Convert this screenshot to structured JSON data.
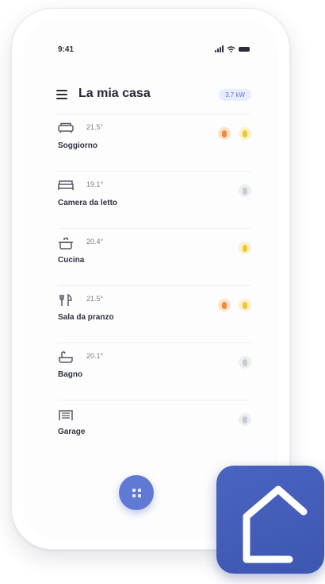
{
  "status_bar": {
    "time": "9:41"
  },
  "header": {
    "title": "La mia casa",
    "badge": "3.7 kW"
  },
  "rooms": [
    {
      "name": "Soggiorno",
      "temperature": "21.5°",
      "icon": "sofa-icon",
      "indicators": [
        "orange",
        "yellow"
      ]
    },
    {
      "name": "Camera da letto",
      "temperature": "19.1°",
      "icon": "bed-icon",
      "indicators": [
        "gray"
      ]
    },
    {
      "name": "Cucina",
      "temperature": "20.4°",
      "icon": "cooking-pot-icon",
      "indicators": [
        "yellow"
      ]
    },
    {
      "name": "Sala da pranzo",
      "temperature": "21.5°",
      "icon": "fork-knife-icon",
      "indicators": [
        "orange",
        "yellow"
      ]
    },
    {
      "name": "Bagno",
      "temperature": "20.1°",
      "icon": "bathtub-icon",
      "indicators": [
        "gray"
      ]
    },
    {
      "name": "Garage",
      "temperature": "",
      "icon": "garage-door-icon",
      "indicators": [
        "gray"
      ]
    }
  ],
  "fab": {
    "icon": "grid-icon"
  },
  "app_icon": {
    "icon": "house-outline-icon"
  },
  "colors": {
    "accent": "#6079d4",
    "app_icon_bg": "#4a64c2",
    "indicator_orange": "#f08a3c",
    "indicator_yellow": "#f3c43a",
    "indicator_gray": "#c7cad2"
  }
}
